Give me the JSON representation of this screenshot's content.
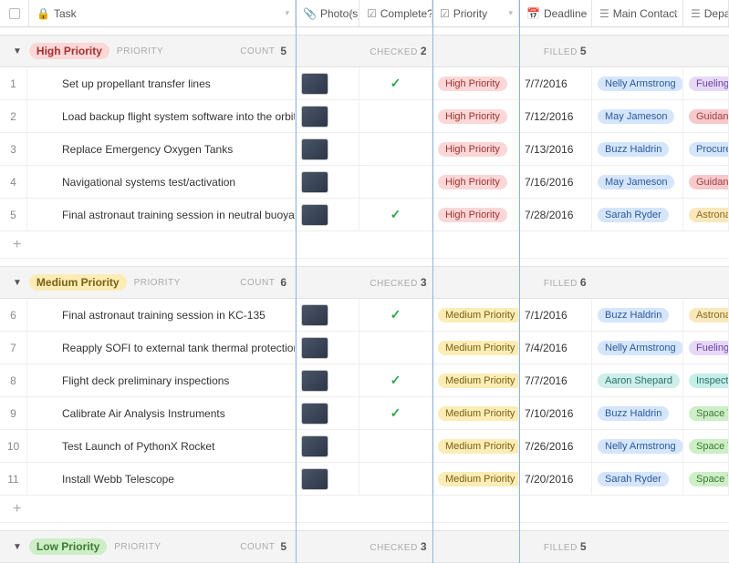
{
  "columns": {
    "task": "Task",
    "photos": "Photo(s)",
    "complete": "Complete?",
    "priority": "Priority",
    "deadline": "Deadline",
    "contact": "Main Contact",
    "dept": "Depar"
  },
  "labels": {
    "priority": "PRIORITY",
    "count": "COUNT",
    "checked": "CHECKED",
    "filled": "FILLED",
    "add": "+"
  },
  "groups": [
    {
      "name": "High Priority",
      "badge_class": "hpbadge",
      "count": 5,
      "checked": 2,
      "filled": 5,
      "rows": [
        {
          "idx": 1,
          "task": "Set up propellant transfer lines",
          "complete": true,
          "priority": "High Priority",
          "priority_class": "hp",
          "deadline": "7/7/2016",
          "contact": "Nelly Armstrong",
          "contact_class": "contact-nelly",
          "dept": "Fueling",
          "dept_class": "dept-fuel"
        },
        {
          "idx": 2,
          "task": "Load backup flight system software into the orbiter",
          "complete": false,
          "priority": "High Priority",
          "priority_class": "hp",
          "deadline": "7/12/2016",
          "contact": "May Jameson",
          "contact_class": "contact-may",
          "dept": "Guidanc",
          "dept_class": "dept-guid"
        },
        {
          "idx": 3,
          "task": "Replace Emergency Oxygen Tanks",
          "complete": false,
          "priority": "High Priority",
          "priority_class": "hp",
          "deadline": "7/13/2016",
          "contact": "Buzz Haldrin",
          "contact_class": "contact-buzz",
          "dept": "Procure",
          "dept_class": "dept-proc"
        },
        {
          "idx": 4,
          "task": "Navigational systems test/activation",
          "complete": false,
          "priority": "High Priority",
          "priority_class": "hp",
          "deadline": "7/16/2016",
          "contact": "May Jameson",
          "contact_class": "contact-may",
          "dept": "Guidanc",
          "dept_class": "dept-guid"
        },
        {
          "idx": 5,
          "task": "Final astronaut training session in neutral buoyan…",
          "complete": true,
          "priority": "High Priority",
          "priority_class": "hp",
          "deadline": "7/28/2016",
          "contact": "Sarah Ryder",
          "contact_class": "contact-sarah",
          "dept": "Astrona",
          "dept_class": "dept-astro"
        }
      ]
    },
    {
      "name": "Medium Priority",
      "badge_class": "mpbadge",
      "count": 6,
      "checked": 3,
      "filled": 6,
      "rows": [
        {
          "idx": 6,
          "task": "Final astronaut training session in KC-135",
          "complete": true,
          "priority": "Medium Priority",
          "priority_class": "mp",
          "deadline": "7/1/2016",
          "contact": "Buzz Haldrin",
          "contact_class": "contact-buzz",
          "dept": "Astrona",
          "dept_class": "dept-astro"
        },
        {
          "idx": 7,
          "task": "Reapply SOFI to external tank thermal protection…",
          "complete": false,
          "priority": "Medium Priority",
          "priority_class": "mp",
          "deadline": "7/4/2016",
          "contact": "Nelly Armstrong",
          "contact_class": "contact-nelly",
          "dept": "Fueling",
          "dept_class": "dept-fuel"
        },
        {
          "idx": 8,
          "task": "Flight deck preliminary inspections",
          "complete": true,
          "priority": "Medium Priority",
          "priority_class": "mp",
          "deadline": "7/7/2016",
          "contact": "Aaron Shepard",
          "contact_class": "contact-aaron",
          "dept": "Inspecti",
          "dept_class": "dept-insp"
        },
        {
          "idx": 9,
          "task": "Calibrate Air Analysis Instruments",
          "complete": true,
          "priority": "Medium Priority",
          "priority_class": "mp",
          "deadline": "7/10/2016",
          "contact": "Buzz Haldrin",
          "contact_class": "contact-buzz",
          "dept": "Space T",
          "dept_class": "dept-space"
        },
        {
          "idx": 10,
          "task": "Test Launch of PythonX Rocket",
          "complete": false,
          "priority": "Medium Priority",
          "priority_class": "mp",
          "deadline": "7/26/2016",
          "contact": "Nelly Armstrong",
          "contact_class": "contact-nelly",
          "dept": "Space T",
          "dept_class": "dept-space"
        },
        {
          "idx": 11,
          "task": "Install Webb Telescope",
          "complete": false,
          "priority": "Medium Priority",
          "priority_class": "mp",
          "deadline": "7/20/2016",
          "contact": "Sarah Ryder",
          "contact_class": "contact-sarah",
          "dept": "Space T",
          "dept_class": "dept-space"
        }
      ]
    },
    {
      "name": "Low Priority",
      "badge_class": "lpbadge",
      "count": 5,
      "checked": 3,
      "filled": 5,
      "rows": []
    }
  ]
}
